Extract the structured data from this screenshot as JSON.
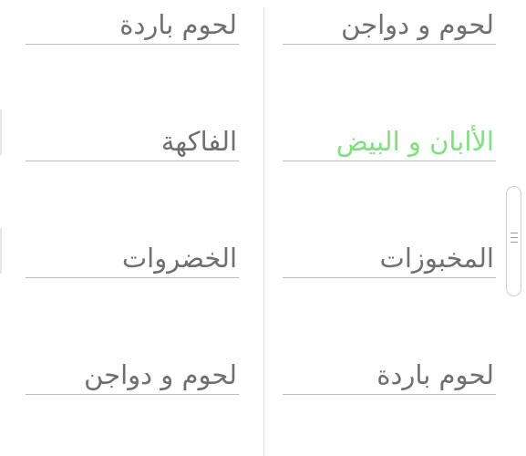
{
  "categories": {
    "left_column": [
      {
        "label": "لحوم باردة"
      },
      {
        "label": "الفاكهة"
      },
      {
        "label": "الخضروات"
      },
      {
        "label": "لحوم و دواجن"
      }
    ],
    "right_column": [
      {
        "label": "لحوم و دواجن"
      },
      {
        "label": "الأابان و البيض",
        "active": true
      },
      {
        "label": "المخبوزات"
      },
      {
        "label": "لحوم باردة"
      }
    ]
  },
  "colors": {
    "active_text": "#7ee081",
    "text": "#6f6f6f",
    "underline": "#bdbdbd",
    "divider": "#dcdcdc"
  },
  "icons": {
    "scroll_handle": "grip-lines-icon"
  }
}
